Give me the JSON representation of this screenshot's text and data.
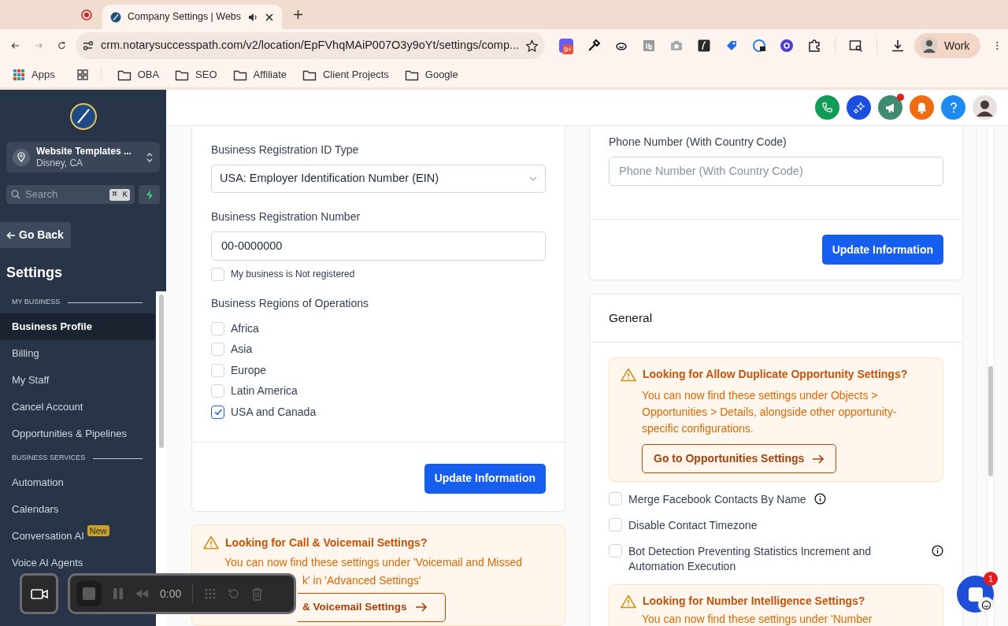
{
  "browser": {
    "tabs": [
      {
        "title": "Company Settings | Webs",
        "selected": true
      }
    ],
    "address": "crm.notarysuccesspath.com/v2/location/EpFVhqMAiP007O3y9oYt/settings/comp...",
    "extension_badge": "9+",
    "profile": "Work",
    "bookmarks": [
      {
        "label": "Apps",
        "kind": "apps"
      },
      {
        "label": "OBA",
        "kind": "folder"
      },
      {
        "label": "SEO",
        "kind": "folder"
      },
      {
        "label": "Affiliate",
        "kind": "folder"
      },
      {
        "label": "Client Projects",
        "kind": "folder"
      },
      {
        "label": "Google",
        "kind": "folder"
      }
    ]
  },
  "sidebar": {
    "account": {
      "name": "Website Templates ...",
      "location": "Disney, CA"
    },
    "search": {
      "placeholder": "Search",
      "shortcut": "⌘ K"
    },
    "back": "Go Back",
    "title": "Settings",
    "sections": [
      {
        "label": "MY BUSINESS",
        "items": [
          {
            "label": "Business Profile",
            "selected": true
          },
          {
            "label": "Billing",
            "selected": false
          },
          {
            "label": "My Staff",
            "selected": false
          },
          {
            "label": "Cancel Account",
            "selected": false
          },
          {
            "label": "Opportunities & Pipelines",
            "selected": false
          }
        ]
      },
      {
        "label": "BUSINESS SERVICES",
        "items": [
          {
            "label": "Automation",
            "selected": false
          },
          {
            "label": "Calendars",
            "selected": false
          },
          {
            "label": "Conversation AI",
            "selected": false,
            "badge": "New"
          },
          {
            "label": "Voice AI Agents",
            "selected": false
          }
        ]
      }
    ]
  },
  "header": {
    "notification_dot": true
  },
  "business_card": {
    "id_type": {
      "label": "Business Registration ID Type",
      "value": "USA: Employer Identification Number (EIN)"
    },
    "number": {
      "label": "Business Registration Number",
      "value": "00-0000000"
    },
    "not_registered": {
      "label": "My business is Not registered",
      "checked": false
    },
    "regions": {
      "label": "Business Regions of Operations",
      "options": [
        {
          "label": "Africa",
          "checked": false
        },
        {
          "label": "Asia",
          "checked": false
        },
        {
          "label": "Europe",
          "checked": false
        },
        {
          "label": "Latin America",
          "checked": false
        },
        {
          "label": "USA and Canada",
          "checked": true
        }
      ]
    },
    "button": "Update Information"
  },
  "call_alert": {
    "title": "Looking for Call & Voicemail Settings?",
    "body_line_1": "You can now find these settings under 'Voicemail and Missed",
    "body_line_2": "k' in 'Advanced Settings'",
    "button": "& Voicemail Settings"
  },
  "phone_card": {
    "label": "Phone Number (With Country Code)",
    "placeholder": "Phone Number (With Country Code)",
    "button": "Update Information"
  },
  "general": {
    "title": "General",
    "alert": {
      "title": "Looking for Allow Duplicate Opportunity Settings?",
      "body": "You can now find these settings under Objects > Opportunities > Details, alongside other opportunity-specific configurations.",
      "button": "Go to Opportunities Settings"
    },
    "options": [
      {
        "label": "Merge Facebook Contacts By Name",
        "checked": false,
        "info": true
      },
      {
        "label": "Disable Contact Timezone",
        "checked": false,
        "info": false
      },
      {
        "label": "Bot Detection Preventing Statistics Increment and Automation Execution",
        "checked": false,
        "info": true
      }
    ],
    "number_alert": {
      "title": "Looking for Number Intelligence Settings?",
      "body": "You can now find these settings under 'Number"
    }
  },
  "recorder": {
    "time": "0:00"
  },
  "chat": {
    "badge": "1"
  }
}
